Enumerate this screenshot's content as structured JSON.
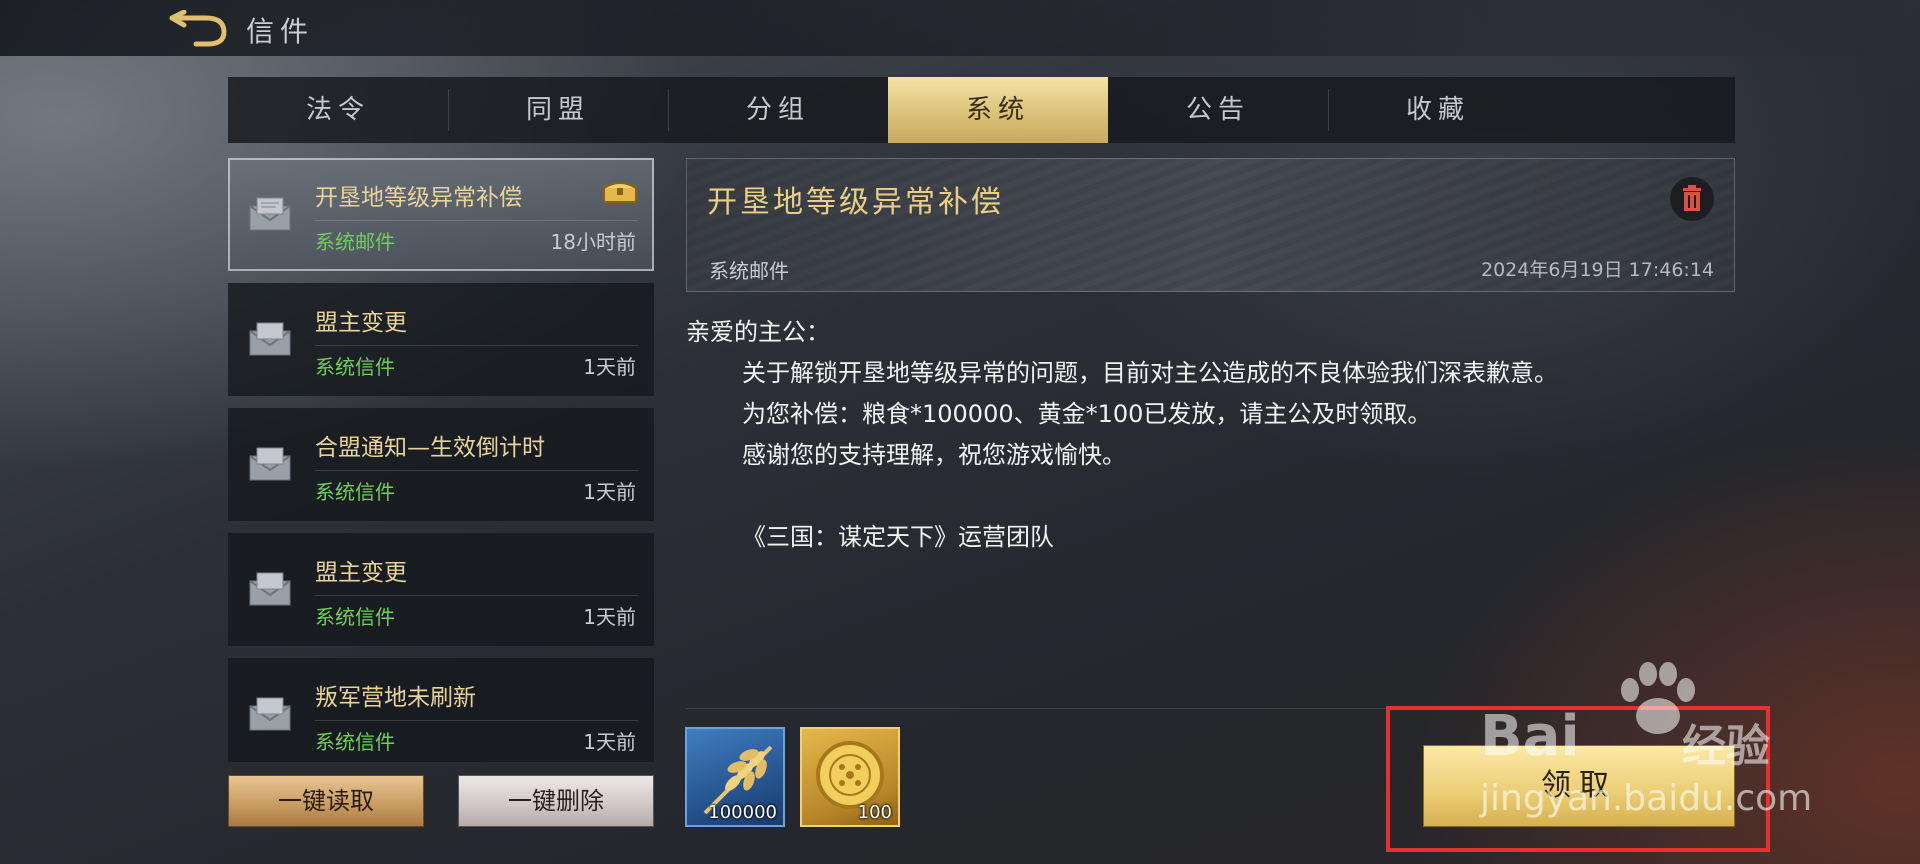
{
  "header": {
    "title": "信件"
  },
  "tabs": [
    {
      "label": "法令"
    },
    {
      "label": "同盟"
    },
    {
      "label": "分组"
    },
    {
      "label": "系统",
      "active": true
    },
    {
      "label": "公告"
    },
    {
      "label": "收藏"
    }
  ],
  "mail_list": [
    {
      "title": "开垦地等级异常补偿",
      "sender": "系统邮件",
      "time": "18小时前",
      "selected": true,
      "has_attachment_icon": "chest-icon"
    },
    {
      "title": "盟主变更",
      "sender": "系统信件",
      "time": "1天前"
    },
    {
      "title": "合盟通知—生效倒计时",
      "sender": "系统信件",
      "time": "1天前"
    },
    {
      "title": "盟主变更",
      "sender": "系统信件",
      "time": "1天前"
    },
    {
      "title": "叛军营地未刷新",
      "sender": "系统信件",
      "time": "1天前"
    }
  ],
  "actions": {
    "read_all": "一键读取",
    "delete_all": "一键删除"
  },
  "detail": {
    "title": "开垦地等级异常补偿",
    "sender": "系统邮件",
    "date": "2024年6月19日 17:46:14",
    "greeting": "亲爱的主公：",
    "lines": [
      "关于解锁开垦地等级异常的问题，目前对主公造成的不良体验我们深表歉意。",
      "为您补偿：粮食*100000、黄金*100已发放，请主公及时领取。",
      "感谢您的支持理解，祝您游戏愉快。"
    ],
    "signature": "《三国：谋定天下》运营团队",
    "rewards": [
      {
        "icon": "grain-icon",
        "quantity": "100000"
      },
      {
        "icon": "gold-coin-icon",
        "quantity": "100"
      }
    ],
    "claim_label": "领取"
  },
  "watermark": {
    "logo": "Bai",
    "brand": "经验",
    "url": "jingyan.baidu.com"
  },
  "colors": {
    "accent_gold": "#e9cf86",
    "sender_green": "#6fcf5a",
    "highlight_red": "#e8312f"
  }
}
